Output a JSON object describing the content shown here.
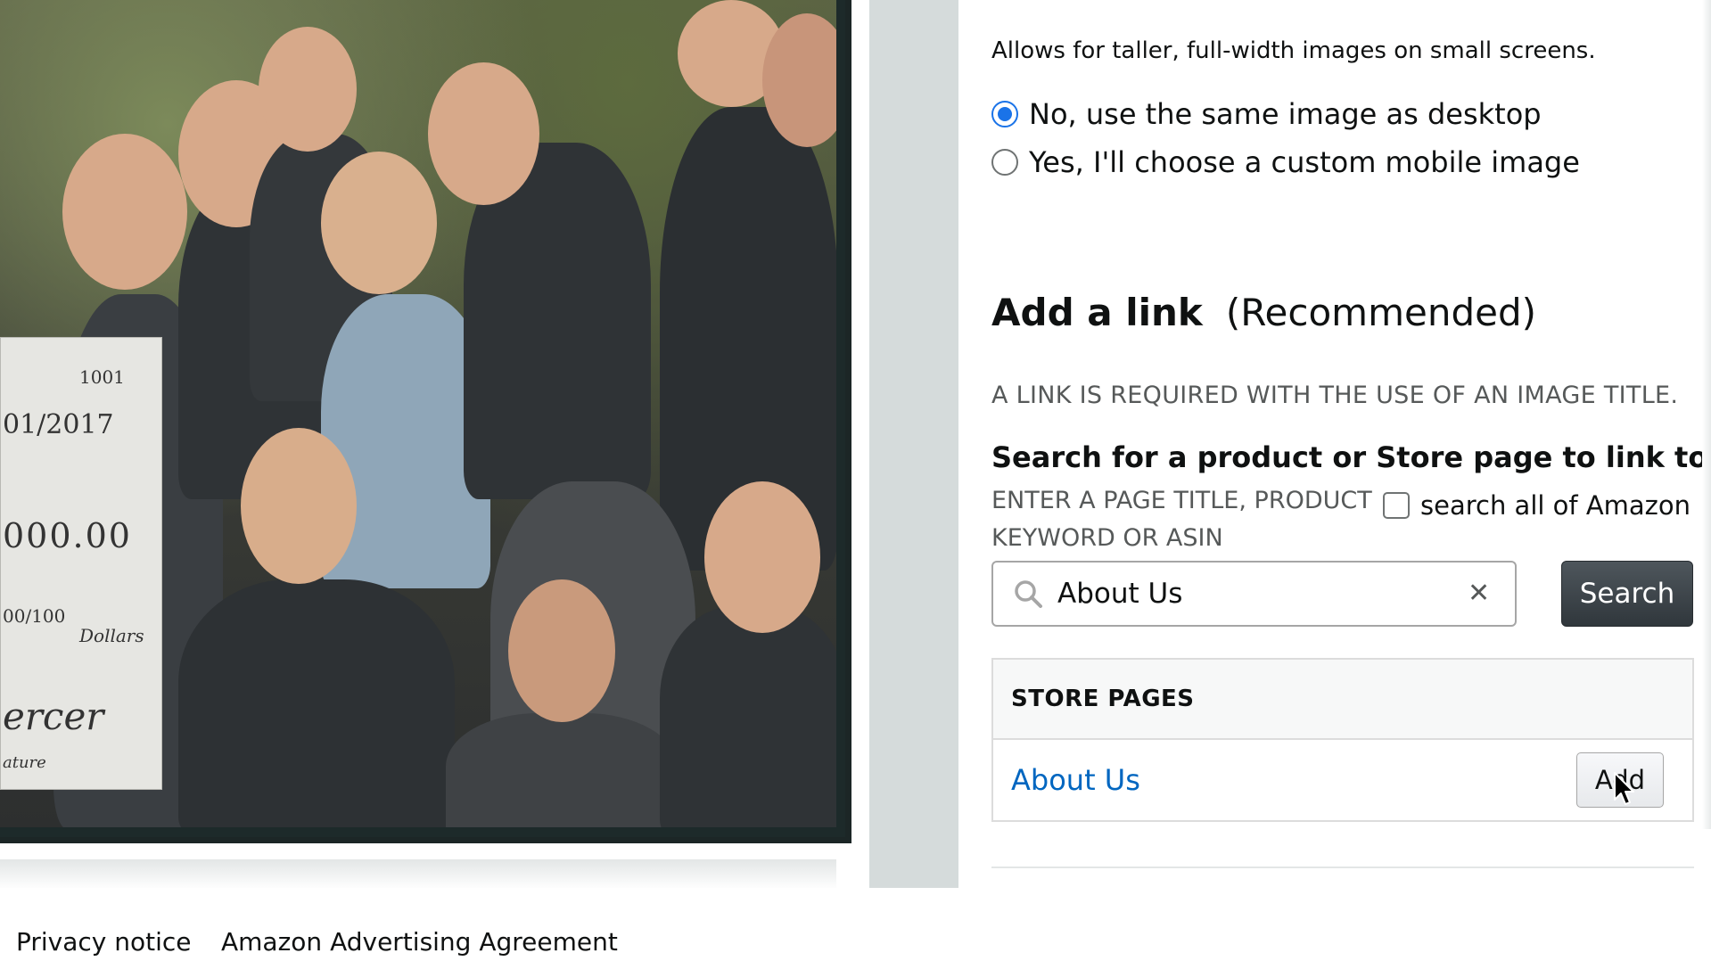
{
  "image_settings": {
    "mobile_hint": "Allows for taller, full-width images on small screens.",
    "mobile_options": [
      {
        "label": "No, use the same image as desktop",
        "selected": true
      },
      {
        "label": "Yes, I'll choose a custom mobile image",
        "selected": false
      }
    ]
  },
  "link_section": {
    "title": "Add a link",
    "title_suffix": "(Recommended)",
    "requirement_note": "A LINK IS REQUIRED WITH THE USE OF AN IMAGE TITLE.",
    "search_heading": "Search for a product or Store page to link to",
    "field_label_line1": "ENTER A PAGE TITLE, PRODUCT",
    "field_label_line2": "KEYWORD OR ASIN",
    "search_all_label": "search all of Amazon",
    "search_all_checked": false,
    "search_value": "About Us",
    "clear_symbol": "✕",
    "search_button": "Search",
    "results": {
      "header": "STORE PAGES",
      "items": [
        {
          "label": "About Us",
          "action": "Add"
        }
      ]
    }
  },
  "photo_check": {
    "number": "1001",
    "date": "01/2017",
    "amount": "000.00",
    "cents": "00/100",
    "currency_word": "Dollars",
    "signature": "ercer",
    "signature_caption": "ature"
  },
  "footer": {
    "privacy": "Privacy notice",
    "agreement": "Amazon Advertising Agreement"
  },
  "colors": {
    "accent_blue": "#1a73e8",
    "link_blue": "#0066c0",
    "dark_button": "#3a4247",
    "gutter_gray": "#d5dbdb"
  }
}
